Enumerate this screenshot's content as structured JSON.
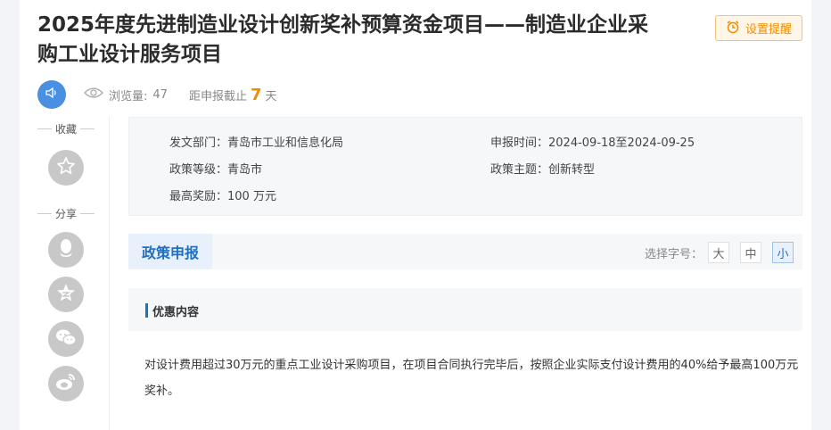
{
  "header": {
    "title": "2025年度先进制造业设计创新奖补预算资金项目——制造业企业采购工业设计服务项目",
    "remind_label": "设置提醒"
  },
  "meta": {
    "views_label": "浏览量:",
    "views_count": "47",
    "deadline_prefix": "距申报截止",
    "deadline_days": "7",
    "deadline_suffix": "天"
  },
  "sidebar": {
    "favorite_label": "收藏",
    "share_label": "分享",
    "share_items": [
      "qq-icon",
      "qzone-icon",
      "wechat-icon",
      "weibo-icon"
    ]
  },
  "info": {
    "department": "发文部门：青岛市工业和信息化局",
    "apply_time": "申报时间：2024-09-18至2024-09-25",
    "level": "政策等级：青岛市",
    "theme": "政策主题：创新转型",
    "max_award": "最高奖励：100 万元"
  },
  "tabs": {
    "active": "政策申报",
    "font_size_label": "选择字号：",
    "sizes": [
      "大",
      "中",
      "小"
    ],
    "selected_size": "小"
  },
  "section": {
    "title": "优惠内容",
    "body": "对设计费用超过30万元的重点工业设计采购项目，在项目合同执行完毕后，按照企业实际支付设计费用的40%给予最高100万元奖补。"
  },
  "colors": {
    "accent": "#1f6fc5",
    "warning": "#f08c00",
    "speaker": "#4a90e2"
  }
}
